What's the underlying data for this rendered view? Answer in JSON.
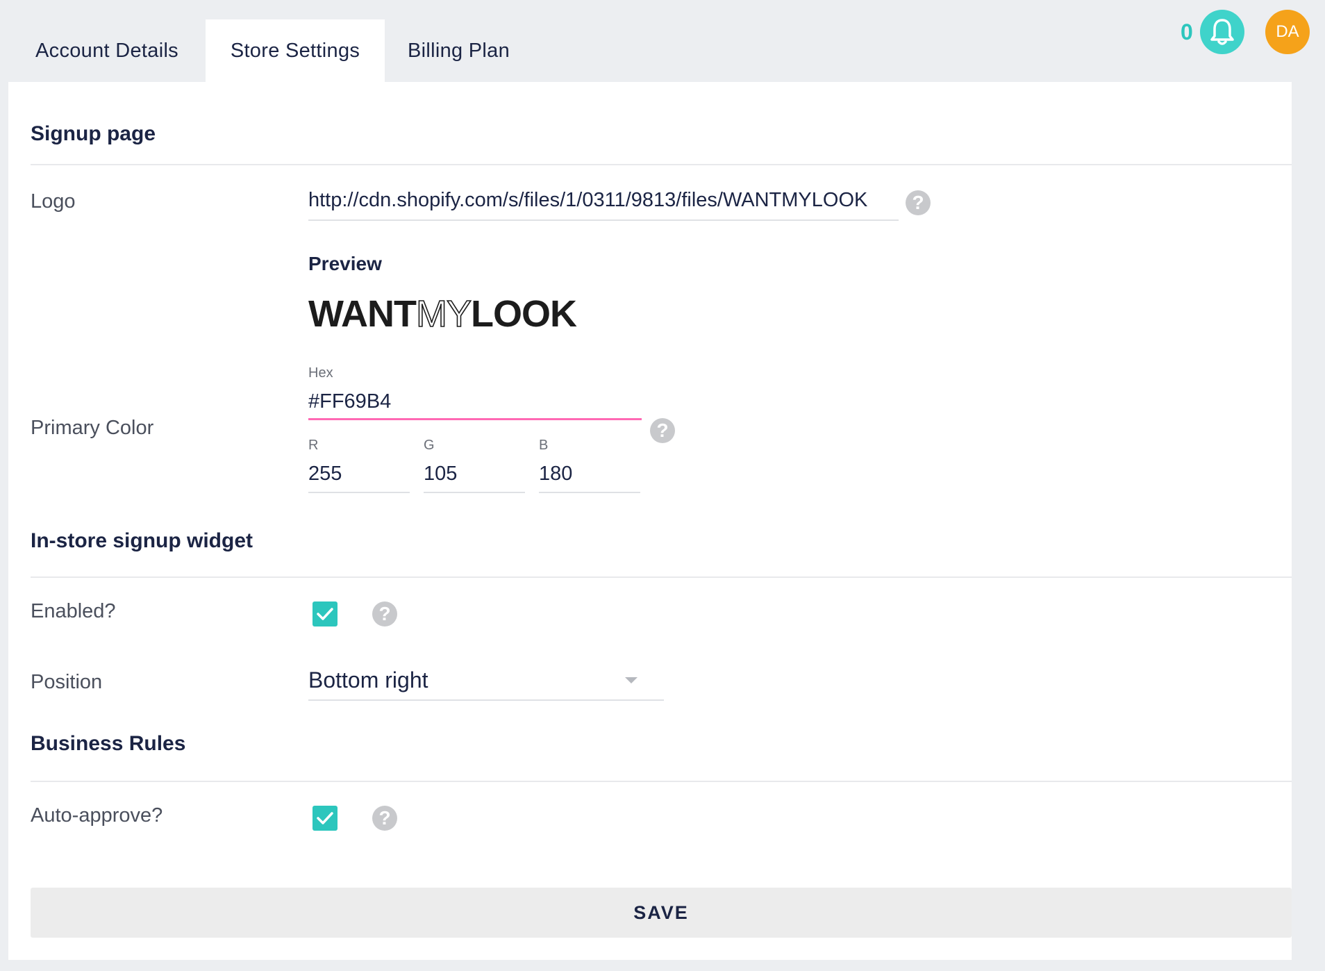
{
  "tabs": [
    "Account Details",
    "Store Settings",
    "Billing Plan"
  ],
  "header": {
    "notification_count": "0",
    "avatar_initials": "DA"
  },
  "signup": {
    "title": "Signup page",
    "logo_label": "Logo",
    "logo_value": "http://cdn.shopify.com/s/files/1/0311/9813/files/WANTMYLOOK",
    "preview_title": "Preview",
    "preview_logo": {
      "part1": "WANT",
      "part2": "MY",
      "part3": "LOOK"
    },
    "primary_color_label": "Primary Color",
    "hex_label": "Hex",
    "hex_value": "#FF69B4",
    "r_label": "R",
    "r_value": "255",
    "g_label": "G",
    "g_value": "105",
    "b_label": "B",
    "b_value": "180"
  },
  "widget": {
    "title": "In-store signup widget",
    "enabled_label": "Enabled?",
    "enabled": true,
    "position_label": "Position",
    "position_value": "Bottom right"
  },
  "business": {
    "title": "Business Rules",
    "auto_approve_label": "Auto-approve?",
    "auto_approve": true
  },
  "save_label": "SAVE",
  "help_glyph": "?",
  "colors": {
    "accent": "#2cc6bd",
    "primary": "#FF69B4",
    "avatar": "#f5a21a",
    "text": "#1b2444"
  }
}
